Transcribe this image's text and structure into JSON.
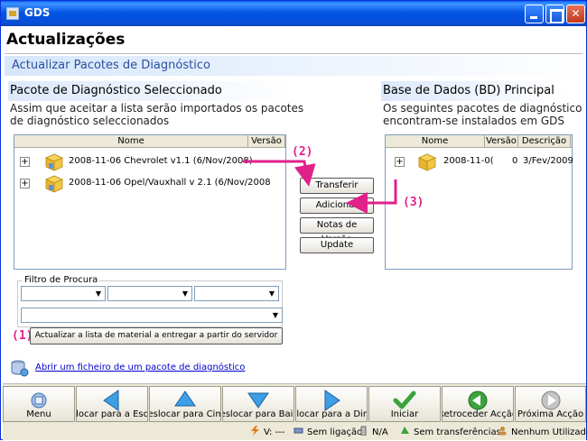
{
  "window": {
    "title": "GDS"
  },
  "header": {
    "title": "Actualizações",
    "section": "Actualizar Pacotes de Diagnóstico"
  },
  "left_panel": {
    "title": "Pacote de Diagnóstico Seleccionado",
    "description_line1": "Assim que aceitar a lista serão importados os pacotes",
    "description_line2": "de diagnóstico seleccionados",
    "columns": [
      "Nome",
      "Versão"
    ],
    "rows": [
      {
        "text": "2008-11-06 Chevrolet v1.1 (6/Nov/2008)"
      },
      {
        "text": "2008-11-06 Opel/Vauxhall v 2.1 (6/Nov/2008"
      }
    ]
  },
  "right_panel": {
    "title": "Base de Dados (BD) Principal",
    "description_line1": "Os seguintes pacotes de diagnóstico",
    "description_line2": "encontram-se instalados em GDS",
    "columns": [
      "Nome",
      "Versão",
      "Descrição"
    ],
    "rows": [
      {
        "name": "2008-11-0(",
        "version": "0",
        "description": "3/Fev/2009"
      }
    ]
  },
  "middle_buttons": {
    "transfer": "Transferir",
    "add": "Adicionar",
    "release_notes": "Notas de Versão",
    "update": "Update"
  },
  "filter": {
    "legend": "Filtro de Procura",
    "update_list_button": "Actualizar a lista de material a entregar a partir do servidor"
  },
  "annotations": {
    "a1": "(1)",
    "a2": "(2)",
    "a3": "(3)"
  },
  "open_package_link": "Abrir um ficheiro de um pacote de diagnóstico",
  "toolbar": [
    {
      "label": "Menu",
      "icon": "menu-icon"
    },
    {
      "label": "Deslocar para a Esquerda",
      "icon": "arrow-left-icon"
    },
    {
      "label": "Deslocar para Cima",
      "icon": "arrow-up-icon"
    },
    {
      "label": "Deslocar para Baixo",
      "icon": "arrow-down-icon"
    },
    {
      "label": "Deslocar para a Direita",
      "icon": "arrow-right-icon"
    },
    {
      "label": "Iniciar",
      "icon": "checkmark-icon"
    },
    {
      "label": "Retroceder Acção",
      "icon": "back-icon"
    },
    {
      "label": "Próxima Acção",
      "icon": "next-icon"
    }
  ],
  "status": {
    "voltage": "V: ---",
    "connection": "Sem ligação",
    "na": "N/A",
    "transfers": "Sem transferências",
    "user": "Nenhum Utilizador"
  },
  "colors": {
    "annotation": "#e0218a",
    "titlebar": "#0857e6",
    "link": "#0000cc"
  }
}
